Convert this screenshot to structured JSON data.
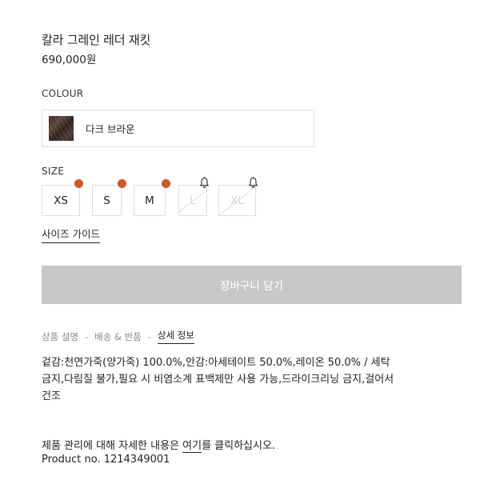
{
  "product": {
    "name": "칼라 그레인 레더 재킷",
    "price": "690,000원"
  },
  "colour": {
    "label": "COLOUR",
    "selected": "다크 브라운",
    "swatch_color": "#3a2a22"
  },
  "size": {
    "label": "SIZE",
    "options": [
      {
        "label": "XS",
        "available": true,
        "indicator": "dot"
      },
      {
        "label": "S",
        "available": true,
        "indicator": "dot"
      },
      {
        "label": "M",
        "available": true,
        "indicator": "dot"
      },
      {
        "label": "L",
        "available": false,
        "indicator": "bell-icon"
      },
      {
        "label": "XL",
        "available": false,
        "indicator": "bell-icon"
      }
    ],
    "dot_color": "#d2552c",
    "guide_link": "사이즈 가이드"
  },
  "cart_button": {
    "label": "장바구니 담기",
    "background": "#c8c8c8"
  },
  "tabs": [
    {
      "label": "상품 설명",
      "active": false
    },
    {
      "label": "배송 & 반품",
      "active": false
    },
    {
      "label": "상세 정보",
      "active": true
    }
  ],
  "tab_separator": "-",
  "details": {
    "composition_line1": "겉감:천연가죽(양가죽) 100.0%,안감:아세테이트 50.0%,레이온 50.0% / 세탁",
    "composition_line2": "금지,다림질 불가,필요 시 비염소계 표백제만 사용 가능,드라이크리닝 금지,걸어서",
    "composition_line3": "건조"
  },
  "care": {
    "text_before": "제품 관리에 대해 자세한 내용은 ",
    "link": "여기",
    "text_after": "를 클릭하십시오."
  },
  "product_number": "Product no. 1214349001"
}
